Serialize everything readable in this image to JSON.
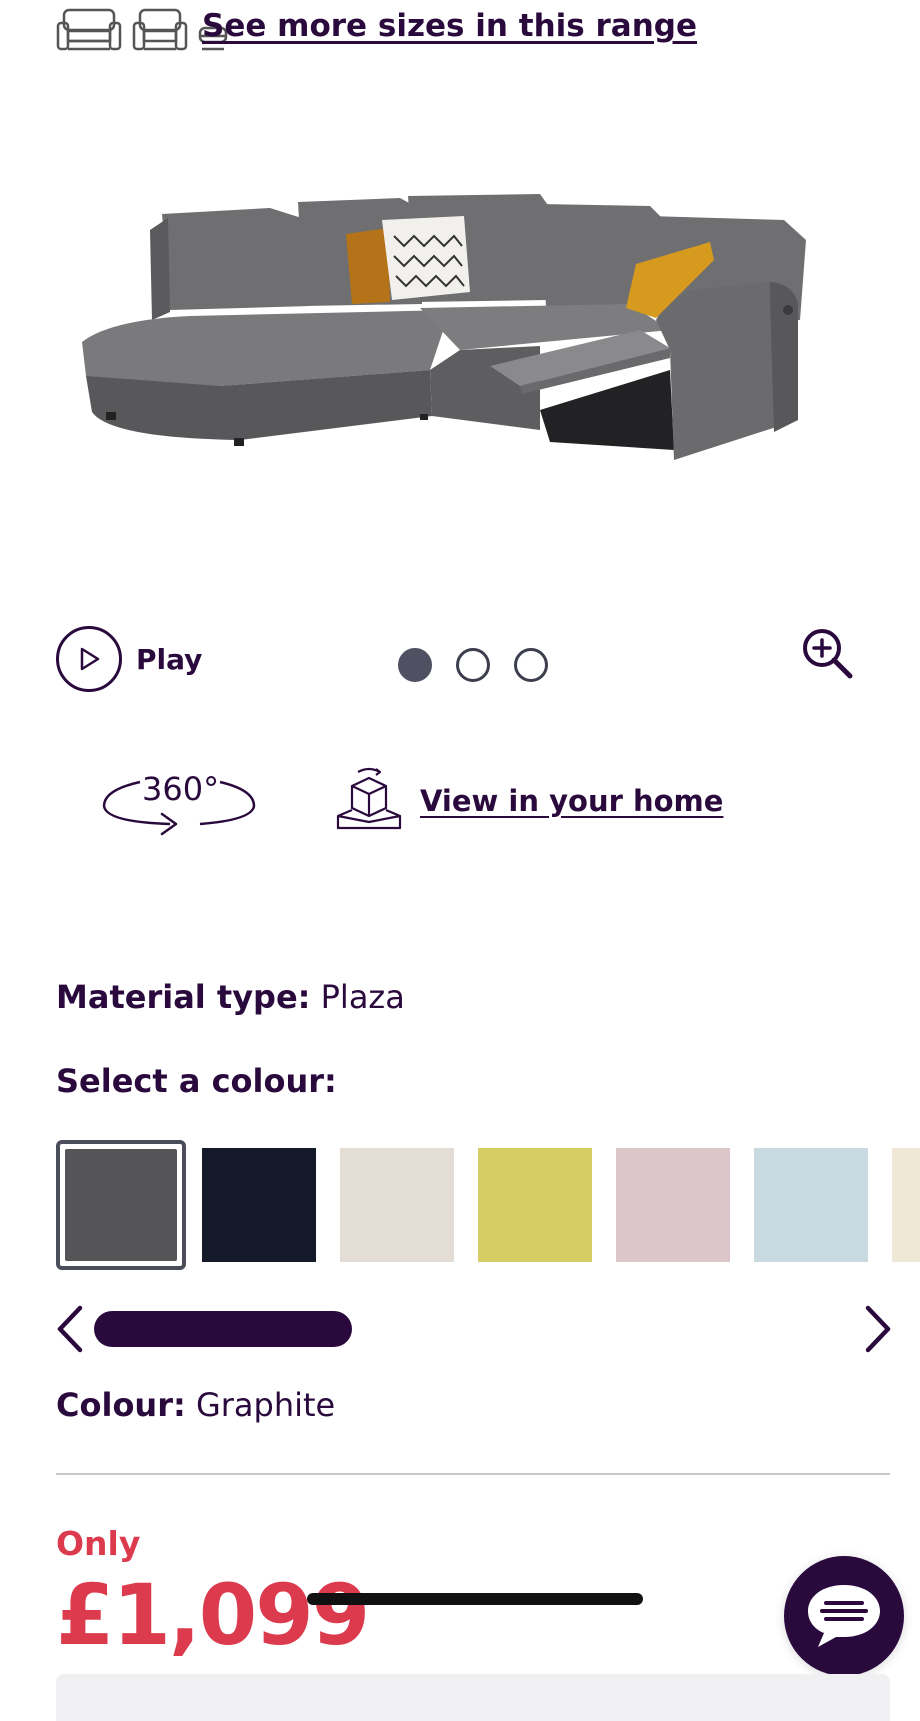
{
  "size_range": {
    "icons": [
      "armchair-icon",
      "sofa-icon",
      "footstool-icon"
    ],
    "link_label": "See more sizes in this range"
  },
  "gallery": {
    "play_label": "Play",
    "slide_count": 3,
    "active_slide": 1,
    "rotate_label": "360°",
    "view_home_label": "View in your home"
  },
  "material": {
    "label": "Material type:",
    "value": "Plaza"
  },
  "colour_select": {
    "label": "Select a colour:",
    "swatches": [
      {
        "name": "Graphite",
        "color": "#555457",
        "selected": true
      },
      {
        "name": "Navy",
        "color": "#141a2a",
        "selected": false
      },
      {
        "name": "Cream",
        "color": "#e3ddd6",
        "selected": false
      },
      {
        "name": "Mustard",
        "color": "#d6cd64",
        "selected": false
      },
      {
        "name": "Blush",
        "color": "#dcc6ca",
        "selected": false
      },
      {
        "name": "Duck Egg",
        "color": "#c8dadf",
        "selected": false
      },
      {
        "name": "Ivory",
        "color": "#efe8d6",
        "selected": false
      }
    ],
    "scroll_fraction": 0.28
  },
  "colour": {
    "label": "Colour:",
    "value": "Graphite"
  },
  "price": {
    "prefix": "Only",
    "value": "£1,099"
  },
  "colors": {
    "brand": "#2a0a3d",
    "price": "#dc3a4d"
  }
}
